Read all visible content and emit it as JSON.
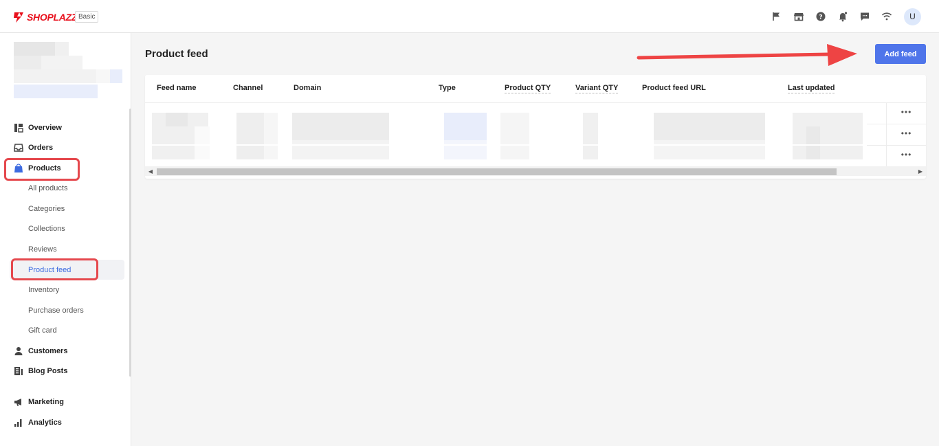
{
  "brand": {
    "name": "SHOPLAZZA",
    "plan": "Basic"
  },
  "header": {
    "icons": [
      "flag-icon",
      "store-icon",
      "help-icon",
      "bell-icon",
      "message-icon",
      "wifi-icon"
    ],
    "avatar_initial": "U"
  },
  "sidebar": {
    "items": [
      {
        "label": "Overview",
        "icon": "dashboard-icon"
      },
      {
        "label": "Orders",
        "icon": "inbox-icon"
      },
      {
        "label": "Products",
        "icon": "bag-icon"
      },
      {
        "label": "Customers",
        "icon": "person-icon"
      },
      {
        "label": "Blog Posts",
        "icon": "document-icon"
      },
      {
        "label": "Marketing",
        "icon": "megaphone-icon"
      },
      {
        "label": "Analytics",
        "icon": "bar-chart-icon"
      }
    ],
    "product_subitems": [
      "All products",
      "Categories",
      "Collections",
      "Reviews",
      "Product feed",
      "Inventory",
      "Purchase orders",
      "Gift card"
    ],
    "active_subitem": "Product feed"
  },
  "main": {
    "title": "Product feed",
    "add_button": "Add feed",
    "table": {
      "columns": [
        "Feed name",
        "Channel",
        "Domain",
        "Type",
        "Product QTY",
        "Variant QTY",
        "Product feed URL",
        "Last updated"
      ],
      "row_action": "•••"
    }
  },
  "colors": {
    "brand_red": "#e8101c",
    "accent_blue": "#4f75ea",
    "highlight_red": "#e5484d"
  }
}
